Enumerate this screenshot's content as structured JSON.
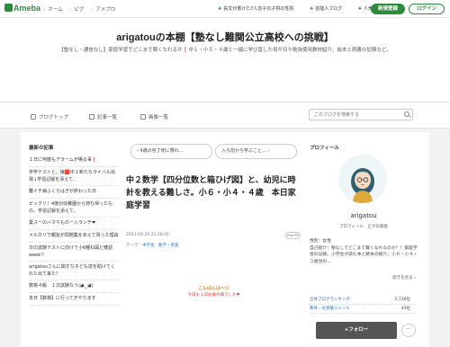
{
  "topbar": {
    "logo": "Ameba",
    "crumbs": [
      "ホーム",
      "ピグ",
      "アメブロ"
    ],
    "links": [
      "長文が書けた7人息子の子供の性別",
      "芸能人ブログ",
      "人気ブログ"
    ],
    "register_label": "新規登録",
    "login_label": "ログイン"
  },
  "header": {
    "title": "arigatouの本棚【塾なし難関公立高校への挑戦】",
    "description": "【塾なし・通信なし】家庭学習でどこまで賢くなれるか❗中１・小５・４歳と一緒に学び直した母が日々勉強使用教材紹介、絵本と読書の記録など。"
  },
  "nav": {
    "items": [
      "ブログトップ",
      "記事一覧",
      "画像一覧"
    ],
    "search_placeholder": "このブログを検索する"
  },
  "sidebar": {
    "recent_title": "最新の記事",
    "recent_items": [
      "１日に何度もアラームが鳴る事❗",
      "学学テストと、娘🟥中１新たなライバル出現↓学習記録を添えて。",
      "難イチ病ふくらはぎが終わった日",
      "ビックリ！4歳が幼稚園から持ち帰ったもの。学習記録を添えて。",
      "葉ス一のハマりものー入ランチ❤",
      "メルカリで親友が問題集をあえて買った理由",
      "次の試験テストに向けて小6種ね図ど確認week!!",
      "arigatouさんに関すな子ども達を助けてくれた出て来た？",
      "数検４級　１次試験なう(◕‿◕)",
      "本日【数検】に行ってきやります"
    ]
  },
  "entry": {
    "prev_label": "4歳の包丁使に慣れ…",
    "next_label": "入ろ前から学ぶこと…",
    "title": "中２数学【四分位数と箱ひげ図】と、幼児に時計を教える難しさ。小６・小４・４歳　本日家庭学習",
    "date": "2023-03-29 21:28:00",
    "theme_label": "テーマ：",
    "theme_value": "中学生　数学・英語",
    "pick_label": "Pick PR",
    "greeting": "こんばんは〜😊",
    "greeting_sub": "今日も１日お疲れ様でした❤"
  },
  "profile": {
    "title": "プロフィール",
    "username": "arigatou",
    "links": "プロフィール　ピグの部屋",
    "text_lines": [
      "性別：女性",
      "自己紹介：塾なしでどこまで賢くなれるのか？！家庭学習の記録。小学生が読む本と絵本の紹介。小６・小４・３歳児の…"
    ],
    "more_label": "続きを見る ›",
    "rank_rows": [
      {
        "label": "全体ブログランキング",
        "value": "2,736位"
      },
      {
        "label": "教育・お受験ジャンル",
        "value": "43位"
      }
    ],
    "follow_label": "+フォロー",
    "more_button": "···"
  },
  "colors": {
    "brand": "#2d8c3c",
    "link": "#2a6ebb",
    "greeting": "#e0881e"
  }
}
